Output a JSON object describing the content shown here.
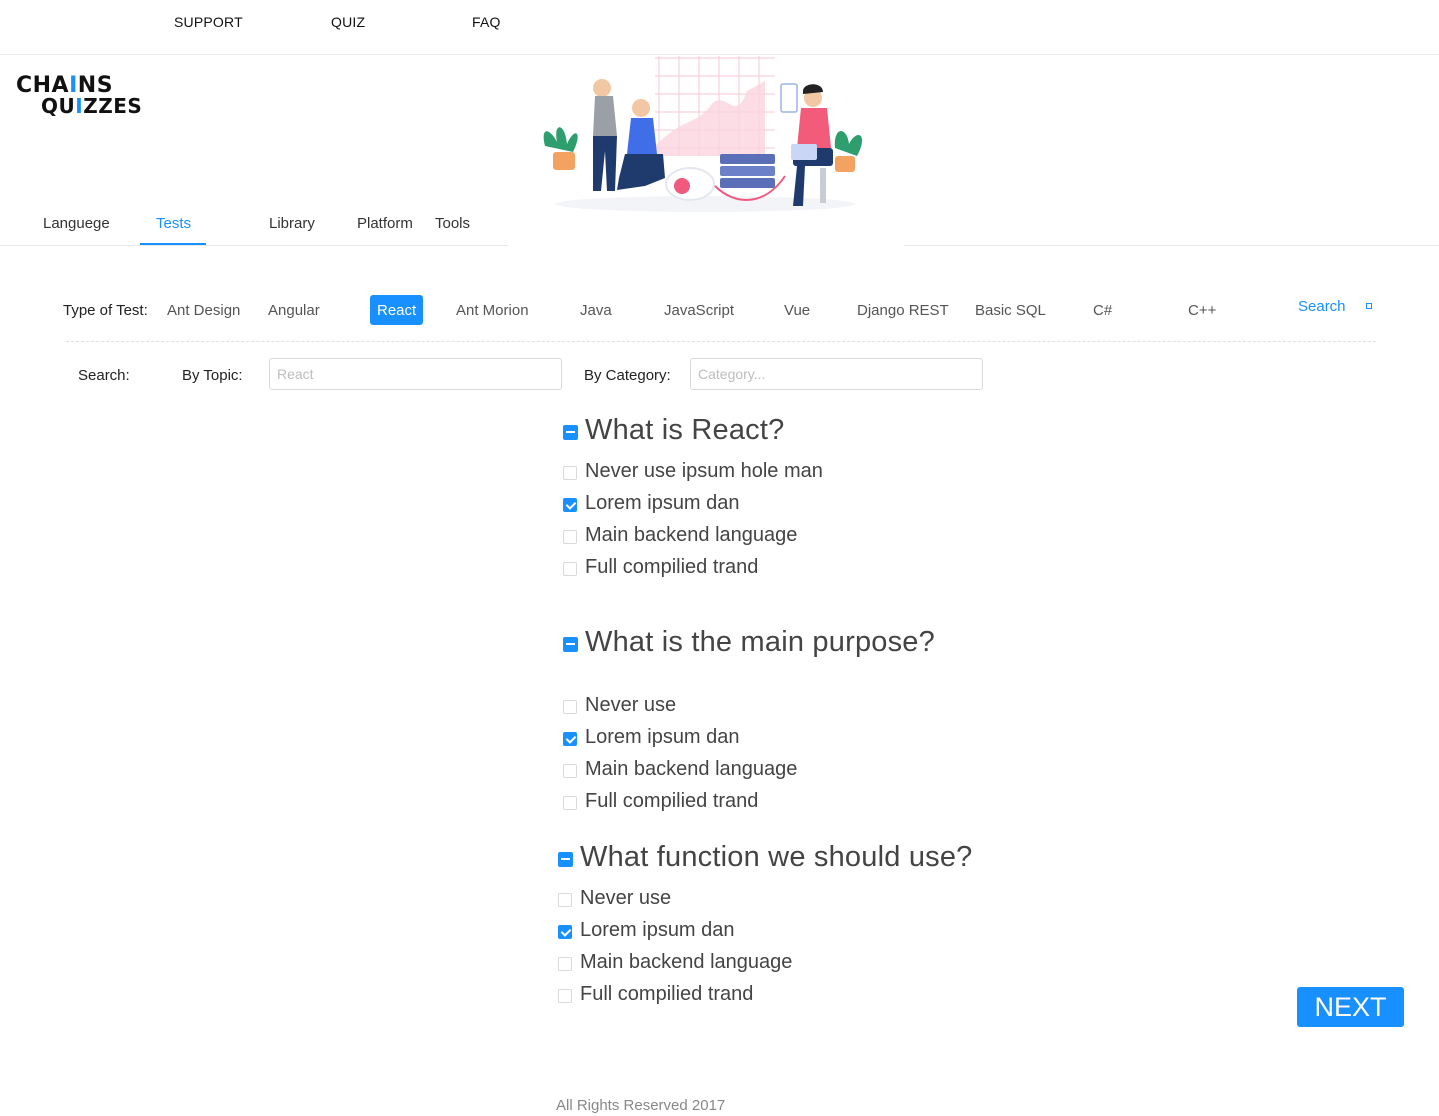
{
  "topnav": {
    "items": [
      {
        "label": "SUPPORT"
      },
      {
        "label": "QUIZ"
      },
      {
        "label": "FAQ"
      }
    ]
  },
  "logo": {
    "line1": "CHA",
    "line1_bar": "I",
    "line1_end": "NS",
    "line2_a": "QU",
    "line2_bar": "I",
    "line2_end": "ZZES"
  },
  "subnav": {
    "items": [
      {
        "label": "Languege",
        "active": false
      },
      {
        "label": "Tests",
        "active": true
      },
      {
        "label": "Library",
        "active": false
      },
      {
        "label": "Platform",
        "active": false
      },
      {
        "label": "Tools",
        "active": false
      }
    ]
  },
  "types": {
    "label": "Type of Test:",
    "tags": [
      {
        "label": "Ant Design"
      },
      {
        "label": "Angular"
      },
      {
        "label": "React",
        "active": true
      },
      {
        "label": "Ant Morion"
      },
      {
        "label": "Java"
      },
      {
        "label": "JavaScript"
      },
      {
        "label": "Vue"
      },
      {
        "label": "Django REST"
      },
      {
        "label": "Basic SQL"
      },
      {
        "label": "C#"
      },
      {
        "label": "C++"
      }
    ],
    "search_link": "Search"
  },
  "filters": {
    "search_label": "Search:",
    "topic_label": "By Topic:",
    "topic_placeholder": "React",
    "category_label": "By Category:",
    "category_placeholder": "Category..."
  },
  "questions": [
    {
      "title": "What is React?",
      "options": [
        {
          "text": "Never use ipsum hole man",
          "checked": false
        },
        {
          "text": "Lorem ipsum dan",
          "checked": true
        },
        {
          "text": "Main backend language",
          "checked": false
        },
        {
          "text": "Full compilied trand",
          "checked": false
        }
      ]
    },
    {
      "title": "What is the main purpose?",
      "options": [
        {
          "text": "Never use",
          "checked": false
        },
        {
          "text": "Lorem ipsum dan",
          "checked": true
        },
        {
          "text": "Main backend language",
          "checked": false
        },
        {
          "text": "Full compilied trand",
          "checked": false
        }
      ]
    },
    {
      "title": "What function we should use?",
      "options": [
        {
          "text": "Never use",
          "checked": false
        },
        {
          "text": "Lorem ipsum dan",
          "checked": true
        },
        {
          "text": "Main backend language",
          "checked": false
        },
        {
          "text": "Full compilied trand",
          "checked": false
        }
      ]
    }
  ],
  "next_button": "NEXT",
  "footer": "All Rights Reserved 2017",
  "colors": {
    "accent": "#1890ff",
    "text": "#444444",
    "border": "#d9d9d9"
  }
}
